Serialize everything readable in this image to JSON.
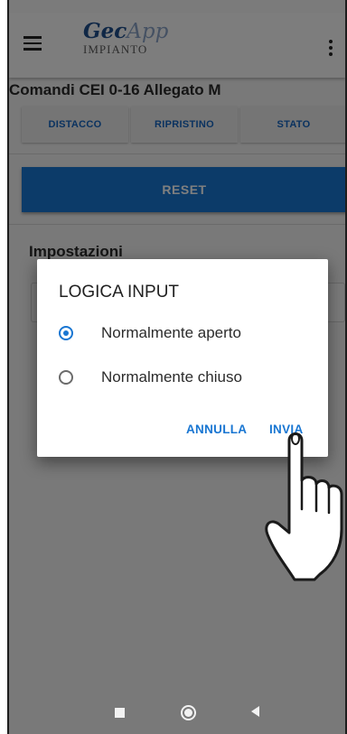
{
  "app": {
    "title_main": "Gec",
    "title_accent": "App",
    "subtitle": "IMPIANTO"
  },
  "header": {
    "menu_icon": "hamburger-menu-icon",
    "overflow_icon": "more-vert-icon"
  },
  "commands": {
    "section_title": "Comandi CEI 0-16 Allegato M",
    "buttons": [
      "DISTACCO",
      "RIPRISTINO",
      "STATO"
    ],
    "reset_label": "RESET"
  },
  "settings": {
    "section_title": "Impostazioni"
  },
  "dialog": {
    "title": "LOGICA INPUT",
    "options": [
      {
        "label": "Normalmente aperto",
        "selected": true
      },
      {
        "label": "Normalmente chiuso",
        "selected": false
      }
    ],
    "cancel_label": "ANNULLA",
    "ok_label": "INVIA"
  },
  "navbar": {
    "icons": [
      "square-recents-icon",
      "circle-home-icon",
      "triangle-back-icon"
    ]
  },
  "colors": {
    "accent": "#1976d2",
    "logo_blue": "#1f4e8c",
    "scrim": "rgba(0,0,0,0.5)"
  }
}
